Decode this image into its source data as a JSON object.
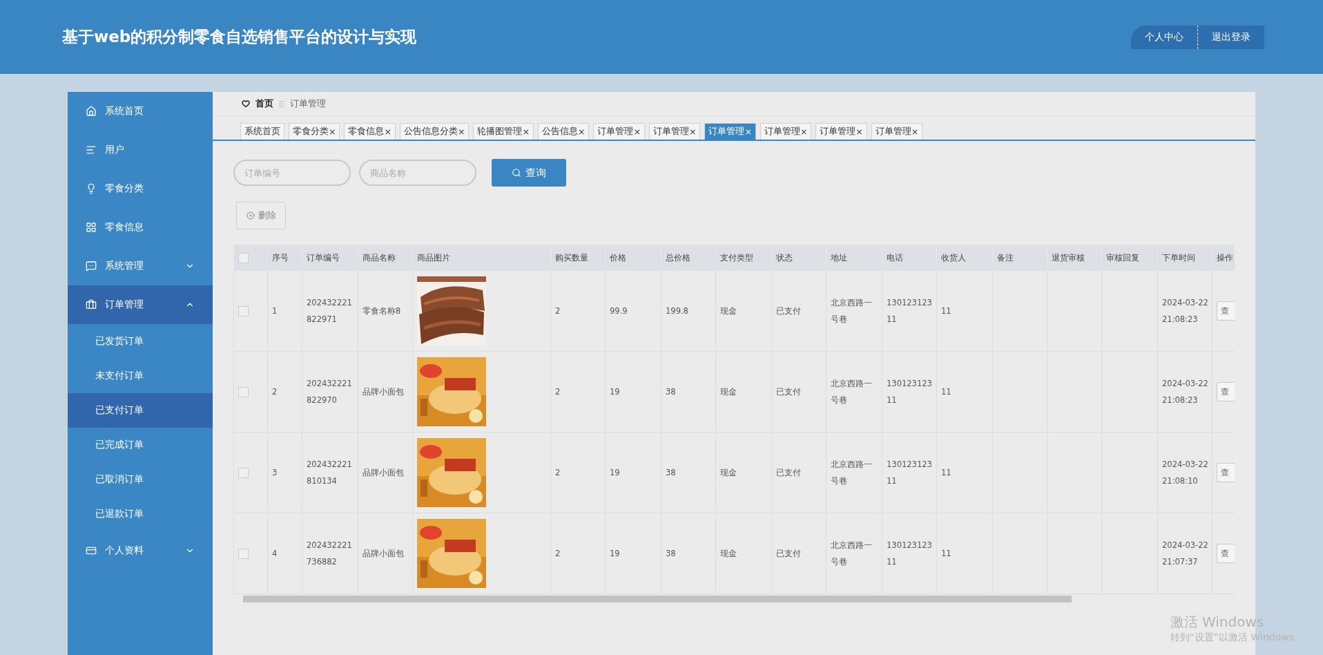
{
  "header": {
    "title": "基于web的积分制零食自选销售平台的设计与实现",
    "actions": [
      {
        "label": "个人中心"
      },
      {
        "label": "退出登录"
      }
    ]
  },
  "sidebar": {
    "items": [
      {
        "label": "系统首页",
        "selected": false
      },
      {
        "label": "用户",
        "selected": false
      },
      {
        "label": "零食分类",
        "selected": false
      },
      {
        "label": "零食信息",
        "selected": false
      },
      {
        "label": "系统管理",
        "selected": false,
        "expanded": false
      },
      {
        "label": "订单管理",
        "selected": true,
        "expanded": true,
        "children": [
          {
            "label": "已发货订单",
            "selected": false
          },
          {
            "label": "未支付订单",
            "selected": false
          },
          {
            "label": "已支付订单",
            "selected": true
          },
          {
            "label": "已完成订单",
            "selected": false
          },
          {
            "label": "已取消订单",
            "selected": false
          },
          {
            "label": "已退款订单",
            "selected": false
          }
        ]
      },
      {
        "label": "个人资料",
        "selected": false,
        "expanded": false
      }
    ]
  },
  "breadcrumb": [
    "首页",
    "订单管理"
  ],
  "tabs": [
    {
      "label": "系统首页",
      "selected": false
    },
    {
      "label": "零食分类",
      "close": "×",
      "selected": false
    },
    {
      "label": "零食信息",
      "close": "×",
      "selected": false
    },
    {
      "label": "公告信息分类",
      "close": "×",
      "selected": false
    },
    {
      "label": "轮播图管理",
      "close": "×",
      "selected": false
    },
    {
      "label": "公告信息",
      "close": "×",
      "selected": false
    },
    {
      "label": "订单管理",
      "close": "×",
      "selected": false
    },
    {
      "label": "订单管理",
      "close": "×",
      "selected": false
    },
    {
      "label": "订单管理",
      "close": "×",
      "selected": true
    },
    {
      "label": "订单管理",
      "close": "×",
      "selected": false
    },
    {
      "label": "订单管理",
      "close": "×",
      "selected": false
    },
    {
      "label": "订单管理",
      "close": "×",
      "selected": false
    }
  ],
  "search": {
    "fields": [
      {
        "placeholder": "订单编号"
      },
      {
        "placeholder": "商品名称"
      }
    ],
    "button": "查询"
  },
  "delete_button": "删除",
  "table": {
    "select_all": {
      "checked": false
    },
    "columns": [
      "序号",
      "订单编号",
      "商品名称",
      "商品图片",
      "购买数量",
      "价格",
      "总价格",
      "支付类型",
      "状态",
      "地址",
      "电话",
      "收货人",
      "备注",
      "退货审核",
      "审核回复",
      "下单时间",
      "操作"
    ],
    "rows": [
      {
        "checked": false,
        "cells": [
          "1",
          "202432221822971",
          "零食名称8",
          {
            "kind": "picture"
          },
          "2",
          "99.9",
          "199.8",
          "现金",
          "已支付",
          "北京西路一号巷",
          "13012312311",
          "11",
          "",
          "",
          "",
          "2024-03-22 21:08:23",
          "查"
        ]
      },
      {
        "checked": false,
        "cells": [
          "2",
          "202432221822970",
          "品牌小面包",
          {
            "kind": "picture"
          },
          "2",
          "19",
          "38",
          "现金",
          "已支付",
          "北京西路一号巷",
          "13012312311",
          "11",
          "",
          "",
          "",
          "2024-03-22 21:08:23",
          "查"
        ]
      },
      {
        "checked": false,
        "cells": [
          "3",
          "202432221810134",
          "品牌小面包",
          {
            "kind": "picture"
          },
          "2",
          "19",
          "38",
          "现金",
          "已支付",
          "北京西路一号巷",
          "13012312311",
          "11",
          "",
          "",
          "",
          "2024-03-22 21:08:10",
          "查"
        ]
      },
      {
        "checked": false,
        "cells": [
          "4",
          "202432221736882",
          "品牌小面包",
          {
            "kind": "picture"
          },
          "2",
          "19",
          "38",
          "现金",
          "已支付",
          "北京西路一号巷",
          "13012312311",
          "11",
          "",
          "",
          "",
          "2024-03-22 21:07:37",
          "查"
        ]
      }
    ]
  },
  "activation": {
    "title": "激活 Windows",
    "subtitle": "转到“设置”以激活 Windows。"
  }
}
